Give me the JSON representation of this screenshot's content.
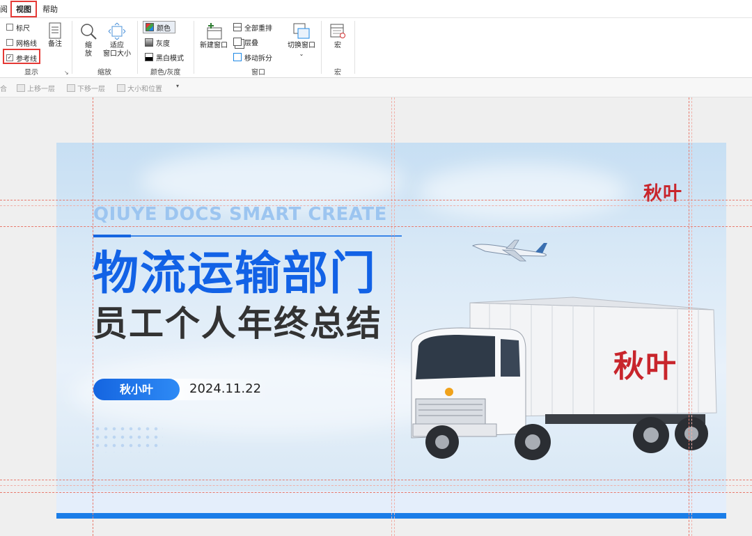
{
  "menubar": {
    "partial_tab": "阅",
    "tabs": [
      {
        "label": "视图",
        "active": true
      },
      {
        "label": "帮助",
        "active": false
      }
    ]
  },
  "ribbon": {
    "show_group": {
      "label": "显示",
      "checkboxes": [
        {
          "label": "标尺",
          "checked": false
        },
        {
          "label": "网格线",
          "checked": false
        },
        {
          "label": "参考线",
          "checked": true
        }
      ],
      "notes_label": "备注"
    },
    "zoom_group": {
      "label": "缩放",
      "zoom_label": "缩\n放",
      "fit_label": "适应\n窗口大小"
    },
    "color_group": {
      "label": "颜色/灰度",
      "options": [
        {
          "label": "颜色",
          "selected": true
        },
        {
          "label": "灰度",
          "selected": false
        },
        {
          "label": "黑白模式",
          "selected": false
        }
      ]
    },
    "window_group": {
      "label": "窗口",
      "new_window": "新建窗口",
      "arrange_all": "全部重排",
      "cascade": "层叠",
      "move_split": "移动拆分",
      "switch_window": "切换窗口"
    },
    "macro_group": {
      "label": "宏",
      "macro": "宏"
    }
  },
  "subbar": {
    "items": [
      "合",
      "上移一层",
      "下移一层",
      "大小和位置"
    ]
  },
  "slide": {
    "en_title": "QIUYE DOCS SMART CREATE",
    "main_title": "物流运输部门",
    "sub_title": "员工个人年终总结",
    "name": "秋小叶",
    "date": "2024.11.22",
    "logo": "秋叶",
    "truck_logo": "秋叶",
    "colors": {
      "title_blue": "#1262e6",
      "accent_blue": "#1a7de8",
      "logo_red": "#c8252c"
    }
  }
}
